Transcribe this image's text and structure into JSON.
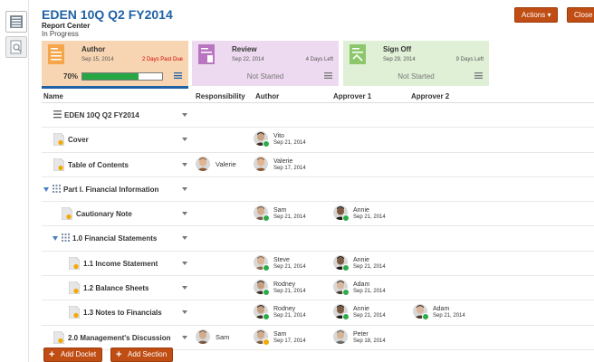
{
  "report": {
    "title": "EDEN 10Q Q2 FY2014",
    "subtitle": "Report Center",
    "status": "In Progress"
  },
  "toolbar": {
    "actions_label": "Actions",
    "close_label": "Close"
  },
  "stages": {
    "author": {
      "name": "Author",
      "date": "Sep 15, 2014",
      "due": "2 Days Past Due",
      "percent_label": "70%",
      "progress": 0.7,
      "color": "#f8d5b2",
      "due_color": "#cc0000"
    },
    "review": {
      "name": "Review",
      "date": "Sep 22, 2014",
      "due": "4 Days Left",
      "status": "Not Started",
      "color": "#eedaf0"
    },
    "signoff": {
      "name": "Sign Off",
      "date": "Sep 29, 2014",
      "due": "9 Days Left",
      "status": "Not Started",
      "color": "#e0f0d6"
    }
  },
  "columns": {
    "name": "Name",
    "responsibility": "Responsibility",
    "author": "Author",
    "approver1": "Approver 1",
    "approver2": "Approver 2"
  },
  "rows": [
    {
      "name": "EDEN 10Q Q2 FY2014",
      "kind": "root"
    },
    {
      "name": "Cover",
      "kind": "doc",
      "author": {
        "name": "Vito",
        "date": "Sep 21, 2014",
        "badge": "ok"
      }
    },
    {
      "name": "Table of Contents",
      "kind": "doc",
      "responsibility": {
        "name": "Valerie"
      },
      "author": {
        "name": "Valerie",
        "date": "Sep 17, 2014",
        "badge": "none"
      }
    },
    {
      "name": "Part I. Financial Information",
      "kind": "section"
    },
    {
      "name": "Cautionary Note",
      "kind": "doc",
      "author": {
        "name": "Sam",
        "date": "Sep 21, 2014",
        "badge": "ok"
      },
      "approver1": {
        "name": "Annie",
        "date": "Sep 21, 2014",
        "badge": "ok"
      }
    },
    {
      "name": "1.0 Financial Statements",
      "kind": "section"
    },
    {
      "name": "1.1 Income Statement",
      "kind": "doc",
      "author": {
        "name": "Steve",
        "date": "Sep 21, 2014",
        "badge": "ok"
      },
      "approver1": {
        "name": "Annie",
        "date": "Sep 21, 2014",
        "badge": "ok"
      }
    },
    {
      "name": "1.2 Balance Sheets",
      "kind": "doc",
      "author": {
        "name": "Rodney",
        "date": "Sep 21, 2014",
        "badge": "ok"
      },
      "approver1": {
        "name": "Adam",
        "date": "Sep 21, 2014",
        "badge": "ok"
      }
    },
    {
      "name": "1.3 Notes to Financials",
      "kind": "doc",
      "author": {
        "name": "Rodney",
        "date": "Sep 21, 2014",
        "badge": "ok"
      },
      "approver1": {
        "name": "Annie",
        "date": "Sep 21, 2014",
        "badge": "ok"
      },
      "approver2": {
        "name": "Adam",
        "date": "Sep 21, 2014",
        "badge": "ok"
      }
    },
    {
      "name": "2.0 Management's Discussion",
      "kind": "doc",
      "responsibility": {
        "name": "Sam"
      },
      "author": {
        "name": "Sam",
        "date": "Sep 17, 2014",
        "badge": "warn"
      },
      "approver1": {
        "name": "Peter",
        "date": "Sep 18, 2014",
        "badge": "none"
      }
    }
  ],
  "footer": {
    "add_doclet": "Add Doclet",
    "add_section": "Add Section"
  },
  "theme": {
    "accent": "#c04d13",
    "title_blue": "#1f62a5",
    "progress_green": "#27a744"
  }
}
